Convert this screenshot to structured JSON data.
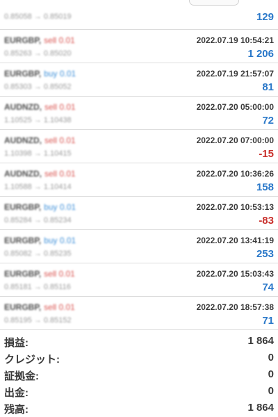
{
  "trades": [
    {
      "symbol": "",
      "side": "",
      "side_type": "buy",
      "prices": "0.85058 → 0.85019",
      "datetime": "",
      "profit": "129",
      "sign": "pos"
    },
    {
      "symbol": "EURGBP,",
      "side": "sell 0.01",
      "side_type": "sell",
      "prices": "0.85263 → 0.85020",
      "datetime": "2022.07.19 10:54:21",
      "profit": "1 206",
      "sign": "pos"
    },
    {
      "symbol": "EURGBP,",
      "side": "buy 0.01",
      "side_type": "buy",
      "prices": "0.85303 → 0.85052",
      "datetime": "2022.07.19 21:57:07",
      "profit": "81",
      "sign": "pos"
    },
    {
      "symbol": "AUDNZD,",
      "side": "sell 0.01",
      "side_type": "sell",
      "prices": "1.10525 → 1.10438",
      "datetime": "2022.07.20 05:00:00",
      "profit": "72",
      "sign": "pos"
    },
    {
      "symbol": "AUDNZD,",
      "side": "sell 0.01",
      "side_type": "sell",
      "prices": "1.10398 → 1.10415",
      "datetime": "2022.07.20 07:00:00",
      "profit": "-15",
      "sign": "neg"
    },
    {
      "symbol": "AUDNZD,",
      "side": "sell 0.01",
      "side_type": "sell",
      "prices": "1.10588 → 1.10414",
      "datetime": "2022.07.20 10:36:26",
      "profit": "158",
      "sign": "pos"
    },
    {
      "symbol": "EURGBP,",
      "side": "buy 0.01",
      "side_type": "buy",
      "prices": "0.85284 → 0.85234",
      "datetime": "2022.07.20 10:53:13",
      "profit": "-83",
      "sign": "neg"
    },
    {
      "symbol": "EURGBP,",
      "side": "buy 0.01",
      "side_type": "buy",
      "prices": "0.85082 → 0.85235",
      "datetime": "2022.07.20 13:41:19",
      "profit": "253",
      "sign": "pos"
    },
    {
      "symbol": "EURGBP,",
      "side": "sell 0.01",
      "side_type": "sell",
      "prices": "0.85181 → 0.85116",
      "datetime": "2022.07.20 15:03:43",
      "profit": "74",
      "sign": "pos"
    },
    {
      "symbol": "EURGBP,",
      "side": "sell 0.01",
      "side_type": "sell",
      "prices": "0.85195 → 0.85152",
      "datetime": "2022.07.20 18:57:38",
      "profit": "71",
      "sign": "pos"
    }
  ],
  "summary": [
    {
      "label": "損益:",
      "value": "1 864"
    },
    {
      "label": "クレジット:",
      "value": "0"
    },
    {
      "label": "証拠金:",
      "value": "0"
    },
    {
      "label": "出金:",
      "value": "0"
    },
    {
      "label": "残高:",
      "value": "1 864"
    }
  ],
  "colors": {
    "positive": "#2a78c9",
    "negative": "#c9302c",
    "sell": "#d9534f",
    "buy": "#3d8fd8"
  }
}
